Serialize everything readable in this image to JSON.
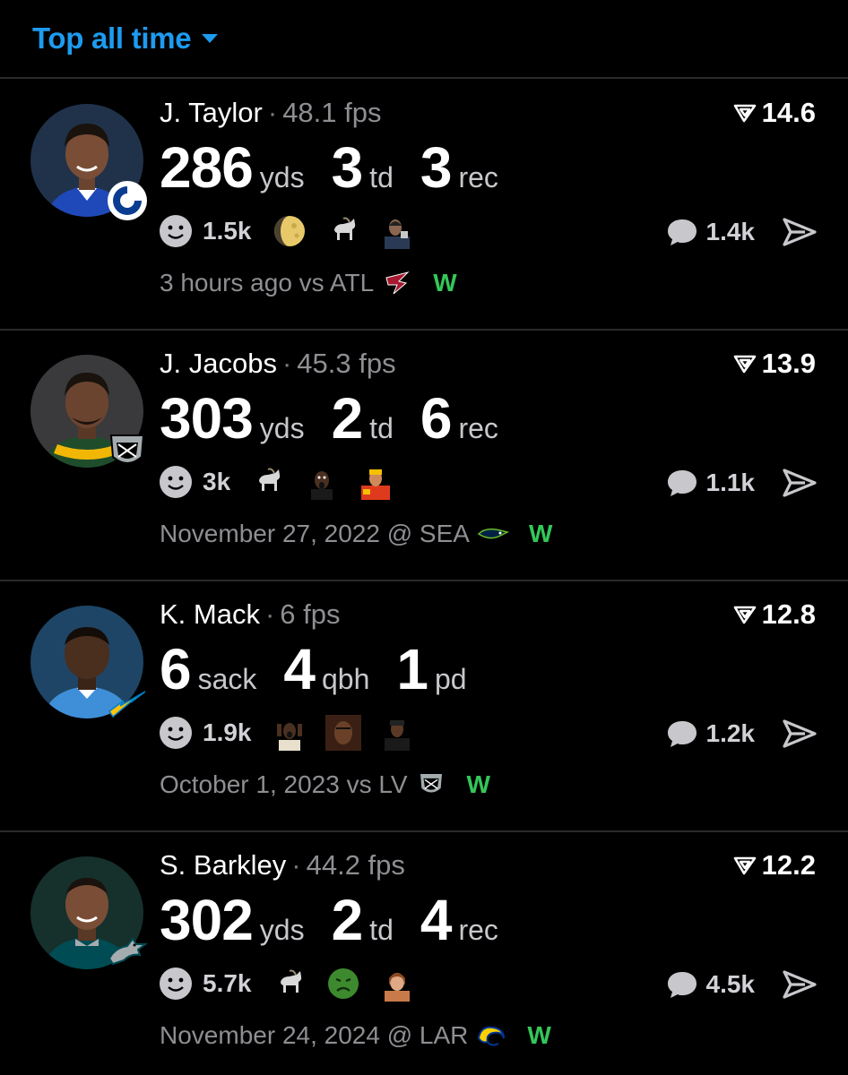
{
  "header": {
    "filter_label": "Top all time"
  },
  "colors": {
    "accent": "#1d9bf0",
    "win": "#34c759",
    "muted": "#8e8e93"
  },
  "cards": [
    {
      "name": "J. Taylor",
      "fps": "48.1 fps",
      "score": "14.6",
      "stats": [
        {
          "num": "286",
          "unit": "yds"
        },
        {
          "num": "3",
          "unit": "td"
        },
        {
          "num": "3",
          "unit": "rec"
        }
      ],
      "reactions": "1.5k",
      "comments": "1.4k",
      "meta": "3 hours ago vs ATL",
      "result": "W",
      "emojis": [
        "moon-icon",
        "goat-icon",
        "reaction-gif-icon"
      ],
      "team": "colts-logo",
      "opponent": "falcons-logo"
    },
    {
      "name": "J. Jacobs",
      "fps": "45.3 fps",
      "score": "13.9",
      "stats": [
        {
          "num": "303",
          "unit": "yds"
        },
        {
          "num": "2",
          "unit": "td"
        },
        {
          "num": "6",
          "unit": "rec"
        }
      ],
      "reactions": "3k",
      "comments": "1.1k",
      "meta": "November 27, 2022 @ SEA",
      "result": "W",
      "emojis": [
        "goat-icon",
        "reaction-gif-icon",
        "reaction-gif-icon"
      ],
      "team": "raiders-logo",
      "opponent": "seahawks-logo"
    },
    {
      "name": "K. Mack",
      "fps": "6 fps",
      "score": "12.8",
      "stats": [
        {
          "num": "6",
          "unit": "sack"
        },
        {
          "num": "4",
          "unit": "qbh"
        },
        {
          "num": "1",
          "unit": "pd"
        }
      ],
      "reactions": "1.9k",
      "comments": "1.2k",
      "meta": "October 1, 2023 vs LV",
      "result": "W",
      "emojis": [
        "reaction-gif-icon",
        "reaction-gif-icon",
        "reaction-gif-icon"
      ],
      "team": "chargers-logo",
      "opponent": "raiders-logo"
    },
    {
      "name": "S. Barkley",
      "fps": "44.2 fps",
      "score": "12.2",
      "stats": [
        {
          "num": "302",
          "unit": "yds"
        },
        {
          "num": "2",
          "unit": "td"
        },
        {
          "num": "4",
          "unit": "rec"
        }
      ],
      "reactions": "5.7k",
      "comments": "4.5k",
      "meta": "November 24, 2024 @ LAR",
      "result": "W",
      "emojis": [
        "goat-icon",
        "nauseated-face-icon",
        "reaction-gif-icon"
      ],
      "team": "eagles-logo",
      "opponent": "rams-logo"
    }
  ]
}
